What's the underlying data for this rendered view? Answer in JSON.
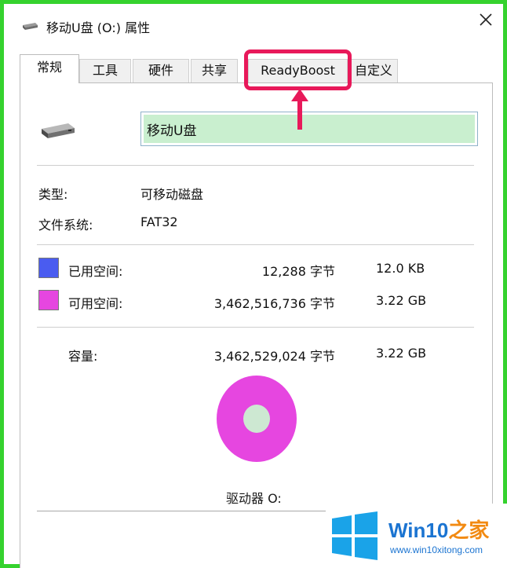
{
  "window": {
    "title": "移动U盘 (O:) 属性",
    "icon": "usb-drive-icon",
    "close_icon": "close-icon"
  },
  "tabs": [
    {
      "label": "常规",
      "active": true
    },
    {
      "label": "工具",
      "active": false
    },
    {
      "label": "硬件",
      "active": false
    },
    {
      "label": "共享",
      "active": false
    },
    {
      "label": "ReadyBoost",
      "active": false
    },
    {
      "label": "自定义",
      "active": false
    }
  ],
  "general": {
    "drive_name": "移动U盘",
    "type_label": "类型:",
    "type_value": "可移动磁盘",
    "fs_label": "文件系统:",
    "fs_value": "FAT32",
    "used": {
      "label": "已用空间:",
      "bytes": "12,288 字节",
      "size": "12.0 KB",
      "color": "#4a5cf0"
    },
    "free": {
      "label": "可用空间:",
      "bytes": "3,462,516,736 字节",
      "size": "3.22 GB",
      "color": "#e646e0"
    },
    "capacity": {
      "label": "容量:",
      "bytes": "3,462,529,024 字节",
      "size": "3.22 GB"
    },
    "drive_label": "驱动器 O:",
    "usage_fraction_used": 3.5e-06
  },
  "annotation": {
    "highlight_color": "#e8195a"
  },
  "watermark": {
    "title_main": "Win10",
    "title_accent": "之家",
    "url": "www.win10xitong.com",
    "logo": "windows-logo-icon"
  },
  "colors": {
    "frame": "#35d22e",
    "pie_free": "#e646e0",
    "pie_center": "#cde8d2",
    "input_fill": "#c9efcf"
  }
}
